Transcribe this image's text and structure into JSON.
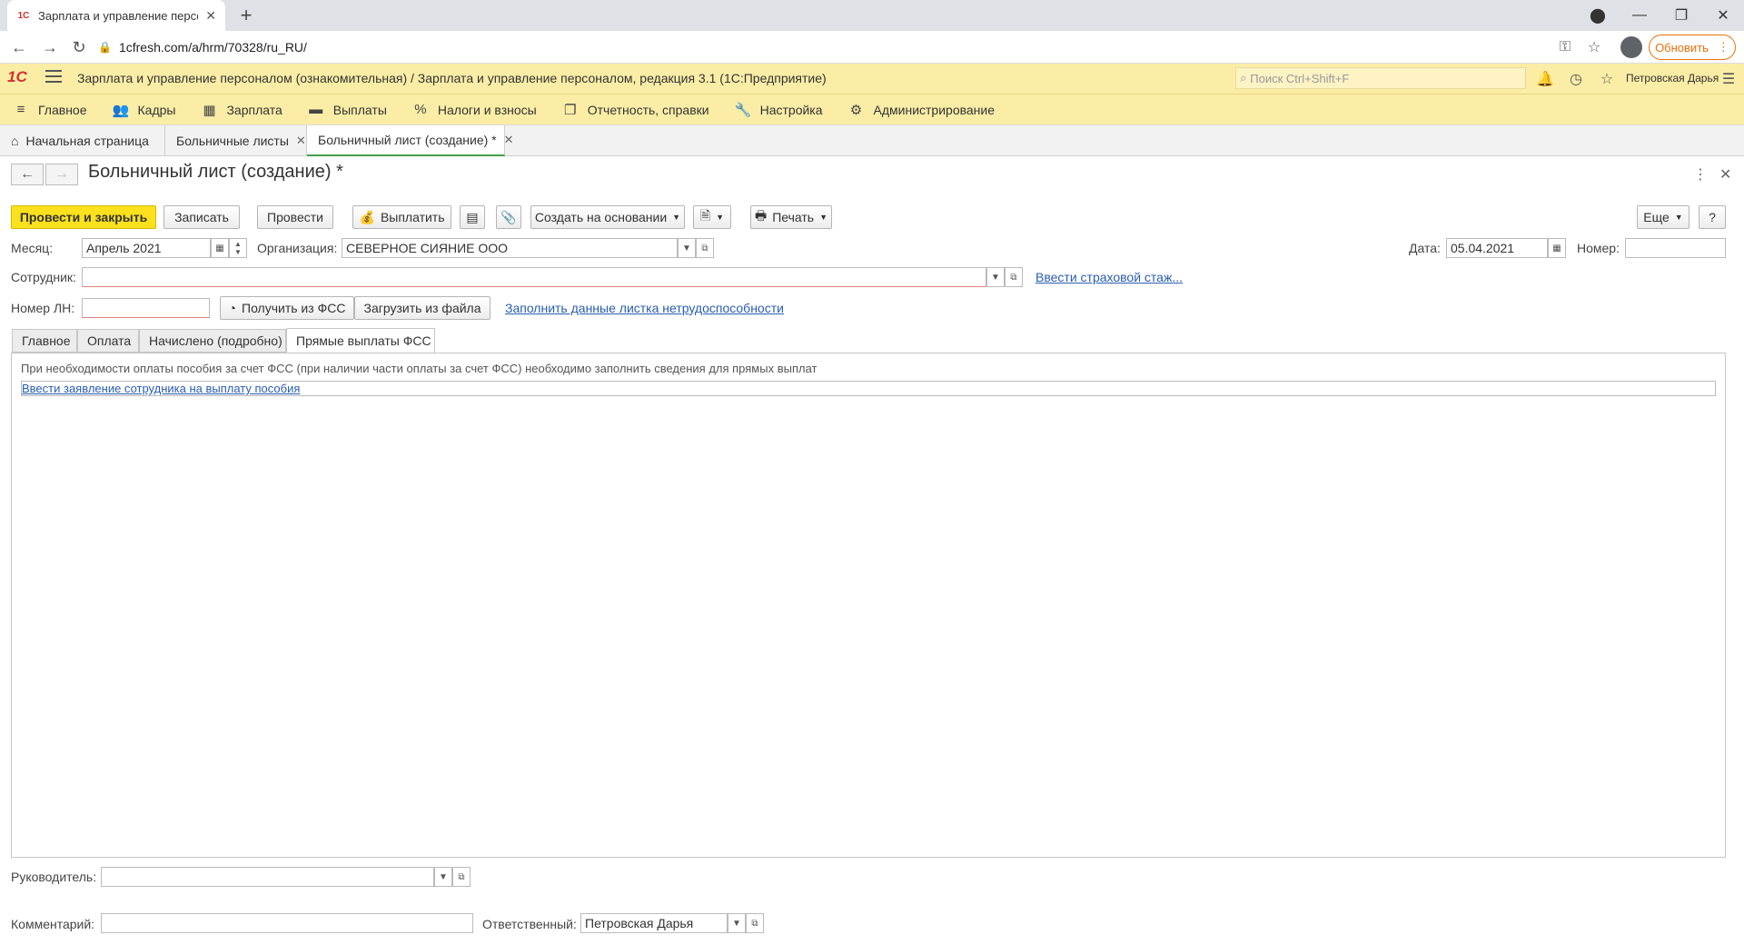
{
  "browser": {
    "tab_title": "Зарплата и управление персон...",
    "favicon": "1С",
    "url": "1cfresh.com/a/hrm/70328/ru_RU/",
    "update_label": "Обновить"
  },
  "app": {
    "logo": "1С",
    "title": "Зарплата и управление персоналом (ознакомительная) / Зарплата и управление персоналом, редакция 3.1  (1С:Предприятие)",
    "search_placeholder": "Поиск Ctrl+Shift+F",
    "user": "Петровская Дарья"
  },
  "sections": [
    {
      "label": "Главное",
      "icon": "≡"
    },
    {
      "label": "Кадры",
      "icon": "👥"
    },
    {
      "label": "Зарплата",
      "icon": "▦"
    },
    {
      "label": "Выплаты",
      "icon": "▬"
    },
    {
      "label": "Налоги и взносы",
      "icon": "%"
    },
    {
      "label": "Отчетность, справки",
      "icon": "❐"
    },
    {
      "label": "Настройка",
      "icon": "🔧"
    },
    {
      "label": "Администрирование",
      "icon": "⚙"
    }
  ],
  "window_tabs": {
    "home": "Начальная страница",
    "list": "Больничные листы",
    "current": "Больничный лист (создание) *"
  },
  "form": {
    "title": "Больничный лист (создание) *",
    "toolbar": {
      "post_close": "Провести и закрыть",
      "save": "Записать",
      "post": "Провести",
      "pay": "Выплатить",
      "create_based": "Создать на основании",
      "print": "Печать",
      "more": "Еще",
      "help": "?"
    },
    "month_label": "Месяц:",
    "month_value": "Апрель 2021",
    "org_label": "Организация:",
    "org_value": "СЕВЕРНОЕ СИЯНИЕ ООО",
    "date_label": "Дата:",
    "date_value": "05.04.2021",
    "number_label": "Номер:",
    "number_value": "",
    "employee_label": "Сотрудник:",
    "employee_value": "",
    "insurance_link": "Ввести страховой стаж...",
    "ln_label": "Номер ЛН:",
    "ln_value": "",
    "get_fss": "Получить из ФСС",
    "load_file": "Загрузить из файла",
    "fill_link": "Заполнить данные листка нетрудоспособности",
    "tabs": [
      "Главное",
      "Оплата",
      "Начислено (подробно)",
      "Прямые выплаты ФСС"
    ],
    "panel_text": "При необходимости оплаты пособия за счет ФСС (при наличии части оплаты за счет ФСС) необходимо заполнить сведения для прямых выплат",
    "panel_link": "Ввести заявление сотрудника на выплату пособия",
    "manager_label": "Руководитель:",
    "manager_value": "",
    "comment_label": "Комментарий:",
    "comment_value": "",
    "responsible_label": "Ответственный:",
    "responsible_value": "Петровская Дарья"
  }
}
